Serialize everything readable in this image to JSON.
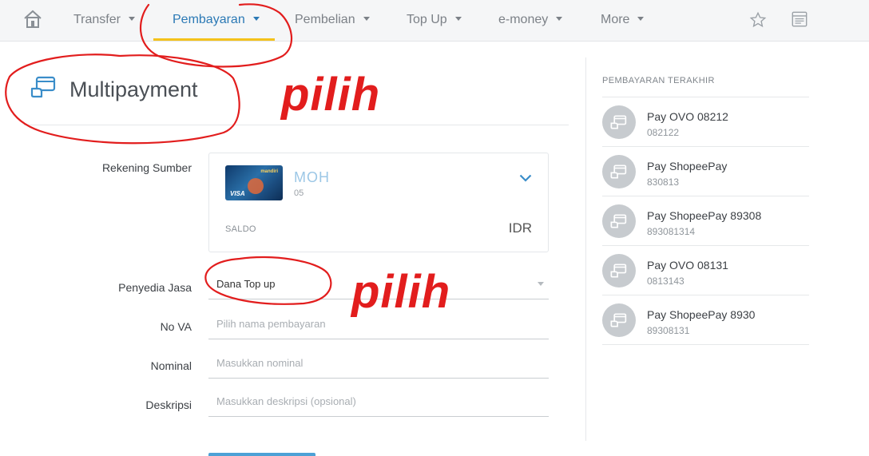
{
  "nav": {
    "items": [
      {
        "label": "Transfer"
      },
      {
        "label": "Pembayaran"
      },
      {
        "label": "Pembelian"
      },
      {
        "label": "Top Up"
      },
      {
        "label": "e-money"
      },
      {
        "label": "More"
      }
    ],
    "active": "Pembayaran"
  },
  "page": {
    "title": "Multipayment"
  },
  "form": {
    "source_label": "Rekening Sumber",
    "source": {
      "card_brand": "mandiri",
      "card_network": "VISA",
      "name_masked": "MOH",
      "number_masked": "05",
      "saldo_label": "SALDO",
      "saldo_value": "IDR"
    },
    "provider_label": "Penyedia Jasa",
    "provider_value": "Dana Top up",
    "va_label": "No VA",
    "va_placeholder": "Pilih nama pembayaran",
    "nominal_label": "Nominal",
    "nominal_placeholder": "Masukkan nominal",
    "desc_label": "Deskripsi",
    "desc_placeholder": "Masukkan deskripsi (opsional)"
  },
  "sidebar": {
    "heading": "PEMBAYARAN TERAKHIR",
    "items": [
      {
        "title": "Pay OVO 08212",
        "sub": "082122"
      },
      {
        "title": "Pay ShopeePay",
        "sub": "830813"
      },
      {
        "title": "Pay ShopeePay 89308",
        "sub": "893081314"
      },
      {
        "title": "Pay OVO 08131",
        "sub": "0813143"
      },
      {
        "title": "Pay ShopeePay 8930",
        "sub": "89308131"
      }
    ]
  },
  "annotations": {
    "pilih_1": "pilih",
    "pilih_2": "pilih"
  },
  "colors": {
    "accent": "#2b79b5",
    "active_underline": "#f4c21b",
    "annotation": "#e21d1d"
  }
}
